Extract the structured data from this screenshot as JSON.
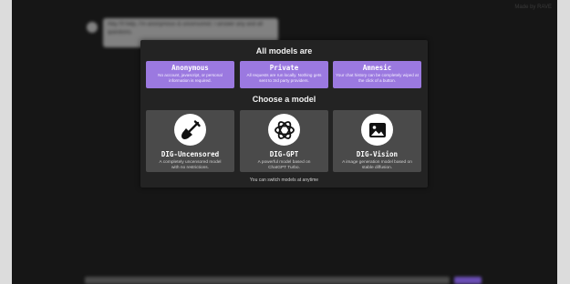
{
  "header": {
    "link_text": "Made by RAVE"
  },
  "background_chat": {
    "message": "Hey I'll help, I'm anonymous & uncensored. I answer any and all questions."
  },
  "modal": {
    "title": "All models are",
    "features": [
      {
        "title": "Anonymous",
        "description": "No account, javascript, or personal information is required."
      },
      {
        "title": "Private",
        "description": "All requests are run locally. Nothing gets sent to 3rd party providers."
      },
      {
        "title": "Amnesic",
        "description": "Your chat history can be completely wiped at the click of a button."
      }
    ],
    "choose_title": "Choose a model",
    "models": [
      {
        "name": "DIG-Uncensored",
        "description": "A completely uncensored model with no restrictions.",
        "icon": "shovel-icon"
      },
      {
        "name": "DIG-GPT",
        "description": "A powerful model based on ChatGPT Turbo.",
        "icon": "openai-logo-icon"
      },
      {
        "name": "DIG-Vision",
        "description": "A image generation model based on stable diffusion.",
        "icon": "image-icon"
      }
    ],
    "footer": "You can switch models at anytime"
  },
  "colors": {
    "accent": "#9b79e0",
    "modal_bg": "#232323",
    "card_bg": "#4a4a4a",
    "app_bg": "#161616"
  }
}
